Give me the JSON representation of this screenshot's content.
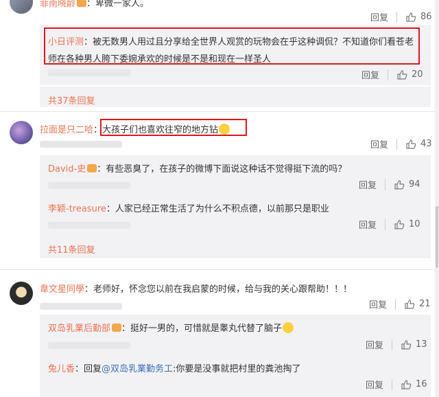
{
  "colors": {
    "name": "#eb7350",
    "link": "#3d6fb5",
    "highlight": "#e0161c"
  },
  "comments": [
    {
      "author": "菲南晓龄",
      "text": "：卑微一家人。",
      "actions": {
        "reply": "回复",
        "likes": "86"
      },
      "replies": [
        {
          "author": "小日评测",
          "text_line1": "：被无数男人用过且分享给全世界人观赏的玩物会在乎这种调侃？不知道你们看苍老",
          "text_line2": "师在各种男人胯下委婉承欢的时候是不是和现在一样圣人",
          "actions": {
            "reply": "回复",
            "likes": "20"
          }
        }
      ],
      "more": "共37条回复"
    },
    {
      "author": "拉面是只二哈",
      "text": "：大孩子们也喜欢往窄的地方钻",
      "actions": {
        "reply": "回复",
        "likes": "43"
      },
      "replies": [
        {
          "author": "David-史",
          "text": "：有些恶臭了，在孩子的微博下面说这种话不觉得挺下流的吗？",
          "actions": {
            "reply": "回复",
            "likes": "94"
          }
        },
        {
          "author": "李颖-treasure",
          "text": "：人家已经正常生活了为什么不积点德，以前那只是职业",
          "actions": {
            "reply": "回复",
            "likes": "10"
          }
        }
      ],
      "more": "共11条回复"
    },
    {
      "author": "韋文星同學",
      "text": "：老师好，怀念您以前在我启蒙的时候，给与我的关心跟帮助！！！",
      "actions": {
        "reply": "回复",
        "likes": "21"
      },
      "replies": [
        {
          "author": "双岛乳業后勤部",
          "text": "：挺好一男的，可惜就是睾丸代替了脑子",
          "actions": {
            "reply": "回复",
            "likes": "13"
          }
        },
        {
          "author": "兔儿香",
          "reply_prefix": "：回复",
          "mention": "@双岛乳業勤务工",
          "text": ":你要是没事就把村里的粪池掏了",
          "actions": {
            "reply": "回复",
            "likes": "16"
          }
        }
      ]
    }
  ]
}
